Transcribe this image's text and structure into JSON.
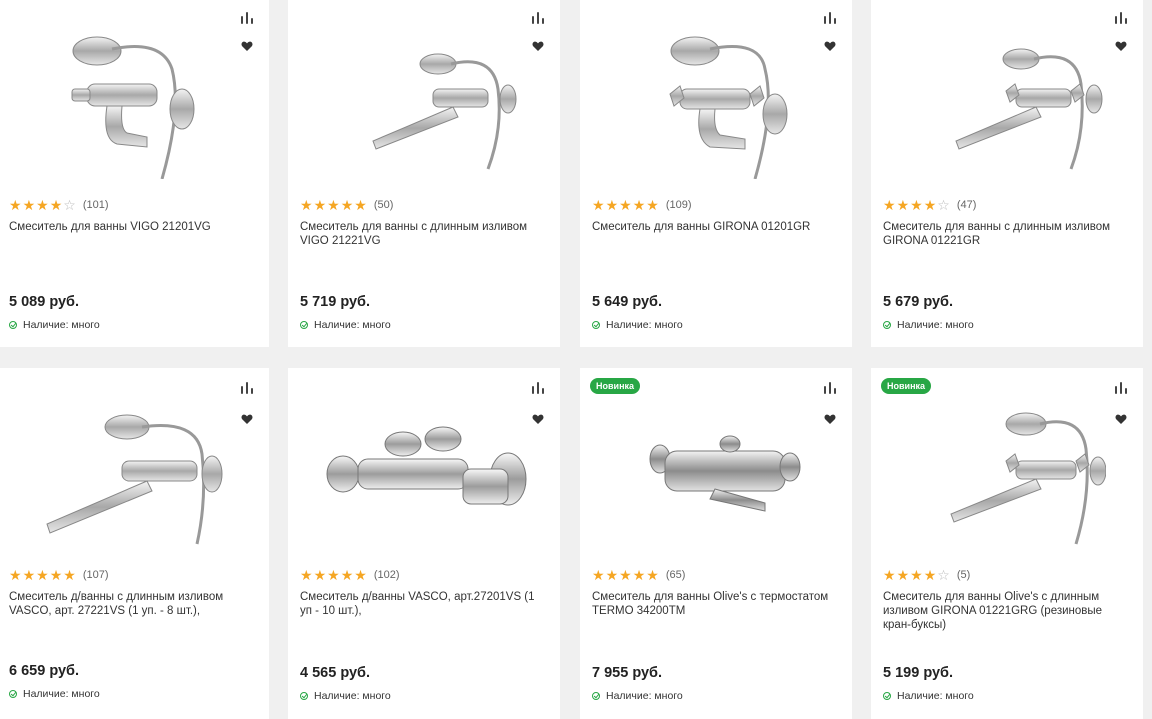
{
  "currency": "руб.",
  "availability_prefix": "Наличие:",
  "colors": {
    "accent": "#28a745",
    "star": "#f5a623",
    "background": "#f0f0f0"
  },
  "icons": {
    "compare": "bar-chart-icon",
    "favorite": "heart-icon",
    "availability": "check-circle-icon"
  },
  "products": [
    {
      "title": "Смеситель для ванны VIGO 21201VG",
      "rating": 4,
      "reviews": "(101)",
      "price": "5 089 руб.",
      "availability": "Наличие: много",
      "badge": ""
    },
    {
      "title": "Смеситель для ванны с длинным изливом VIGO 21221VG",
      "rating": 5,
      "reviews": "(50)",
      "price": "5 719 руб.",
      "availability": "Наличие: много",
      "badge": ""
    },
    {
      "title": "Смеситель для ванны GIRONA 01201GR",
      "rating": 5,
      "reviews": "(109)",
      "price": "5 649 руб.",
      "availability": "Наличие: много",
      "badge": ""
    },
    {
      "title": "Смеситель для ванны с длинным изливом GIRONA 01221GR",
      "rating": 4,
      "reviews": "(47)",
      "price": "5 679 руб.",
      "availability": "Наличие: много",
      "badge": ""
    },
    {
      "title": "Смеситель д/ванны с длинным изливом VASCO, арт. 27221VS (1 уп. - 8 шт.),",
      "rating": 5,
      "reviews": "(107)",
      "price": "6 659 руб.",
      "availability": "Наличие: много",
      "badge": ""
    },
    {
      "title": "Смеситель д/ванны VASCO, арт.27201VS (1 уп - 10 шт.),",
      "rating": 5,
      "reviews": "(102)",
      "price": "4 565 руб.",
      "availability": "Наличие: много",
      "badge": ""
    },
    {
      "title": "Смеситель для ванны Olive's с термостатом TERMO 34200TM",
      "rating": 5,
      "reviews": "(65)",
      "price": "7 955 руб.",
      "availability": "Наличие: много",
      "badge": "Новинка"
    },
    {
      "title": "Смеситель для ванны Olive's с длинным изливом GIRONA 01221GRG (резиновые кран-буксы)",
      "rating": 4,
      "reviews": "(5)",
      "price": "5 199 руб.",
      "availability": "Наличие: много",
      "badge": "Новинка"
    }
  ]
}
